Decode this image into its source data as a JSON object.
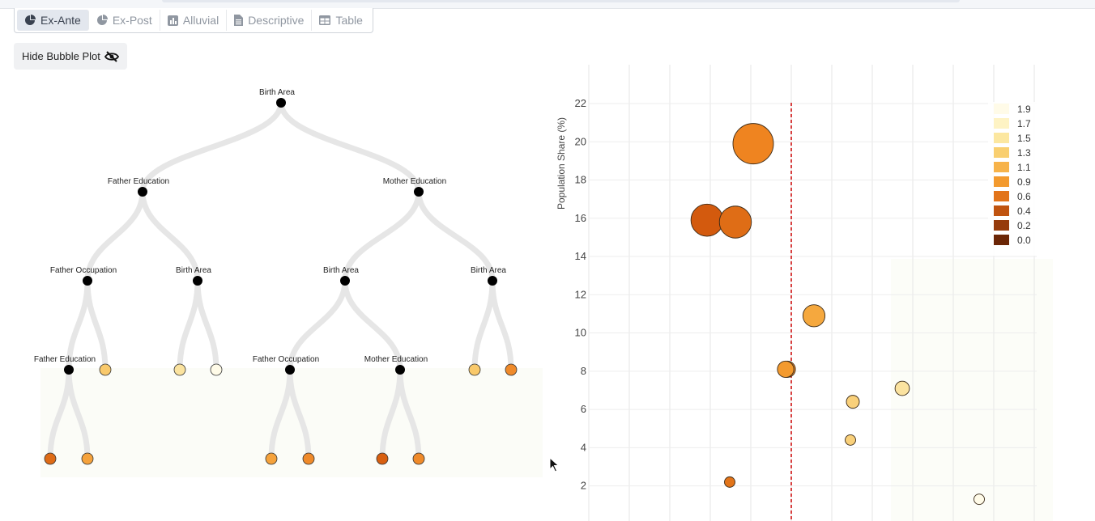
{
  "tabs": [
    {
      "label": "Ex-Ante",
      "icon": "pie-chart-icon",
      "active": true
    },
    {
      "label": "Ex-Post",
      "icon": "pie-chart-icon",
      "active": false
    },
    {
      "label": "Alluvial",
      "icon": "bar-chart-icon",
      "active": false
    },
    {
      "label": "Descriptive",
      "icon": "document-icon",
      "active": false
    },
    {
      "label": "Table",
      "icon": "table-icon",
      "active": false
    }
  ],
  "hide_button": {
    "label": "Hide Bubble Plot",
    "icon": "eye-slash-icon"
  },
  "tree": {
    "labels": {
      "root": "Birth Area",
      "l1_left": "Father Education",
      "l1_right": "Mother Education",
      "l2_a": "Father Occupation",
      "l2_b": "Birth Area",
      "l2_c": "Birth Area",
      "l2_d": "Birth Area",
      "l3_a": "Father Education",
      "l3_c": "Father Occupation",
      "l3_d": "Mother Education"
    },
    "leaf_colors": {
      "l3_b": "#f9c96b",
      "l3_e": "#fbe39f",
      "l3_f": "#fffbe8",
      "l3_g": "#f9c96b",
      "l3_h": "#ef8a2a",
      "l4_a": "#de6b16",
      "l4_b": "#f5a23c",
      "l4_c": "#f5a23c",
      "l4_d": "#ef8a2a",
      "l4_e": "#d85f10",
      "l4_f": "#ef8a2a"
    }
  },
  "chart_data": {
    "type": "scatter",
    "ylabel": "Population Share (%)",
    "xlabel": "",
    "ylim": [
      0,
      23
    ],
    "yticks": [
      2,
      4,
      6,
      8,
      10,
      12,
      14,
      16,
      18,
      20,
      22
    ],
    "reference_line": {
      "style": "dashed",
      "color": "#cc0000"
    },
    "legend_placement": "top-right",
    "legend": [
      {
        "label": "1.9",
        "color": "#fffbe8"
      },
      {
        "label": "1.7",
        "color": "#fef3c4"
      },
      {
        "label": "1.5",
        "color": "#fce7a0"
      },
      {
        "label": "1.3",
        "color": "#f9cf70"
      },
      {
        "label": "1.1",
        "color": "#f7b34a"
      },
      {
        "label": "0.9",
        "color": "#f39a2e"
      },
      {
        "label": "0.6",
        "color": "#e2741a"
      },
      {
        "label": "0.4",
        "color": "#c05410"
      },
      {
        "label": "0.2",
        "color": "#963b0c"
      },
      {
        "label": "0.0",
        "color": "#6b2606"
      }
    ],
    "points": [
      {
        "y": 19.9,
        "size": 20.0,
        "color": "#ef8420"
      },
      {
        "y": 15.9,
        "size": 15.9,
        "color": "#d35a0e"
      },
      {
        "y": 15.8,
        "size": 15.8,
        "color": "#df6d16"
      },
      {
        "y": 10.9,
        "size": 10.9,
        "color": "#f5a83e"
      },
      {
        "y": 8.1,
        "size": 8.1,
        "color": "#ef8a2a"
      },
      {
        "y": 8.1,
        "size": 8.1,
        "color": "#f39a2e"
      },
      {
        "y": 7.1,
        "size": 7.1,
        "color": "#fbe3a0"
      },
      {
        "y": 6.4,
        "size": 6.4,
        "color": "#f9d07a"
      },
      {
        "y": 4.4,
        "size": 4.4,
        "color": "#f9d07a"
      },
      {
        "y": 2.2,
        "size": 2.2,
        "color": "#e2741a"
      },
      {
        "y": 1.3,
        "size": 1.3,
        "color": "#fffbe8"
      }
    ]
  }
}
